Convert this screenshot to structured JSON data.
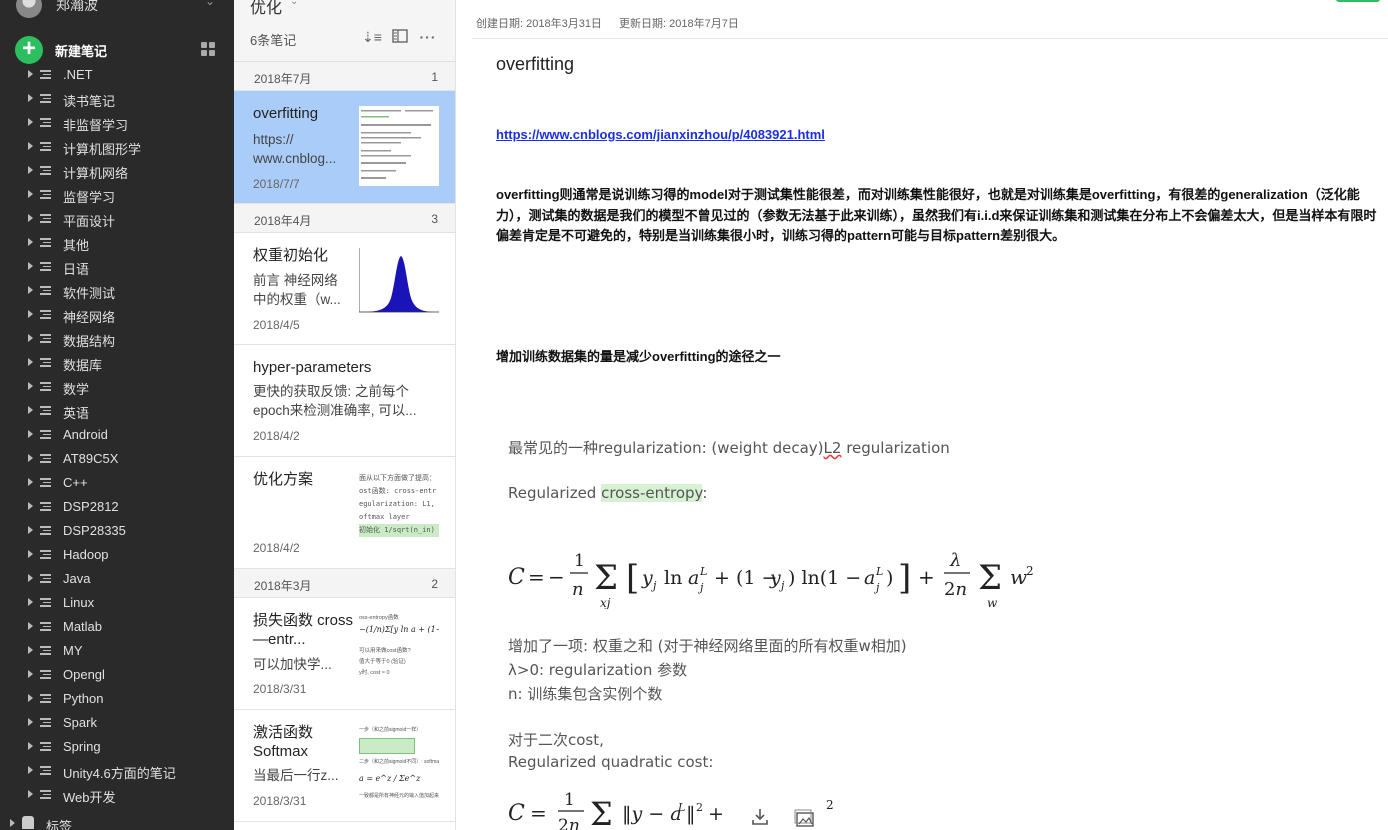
{
  "sidebar": {
    "username": "郑瀚波",
    "new_note_label": "新建笔记",
    "notebooks": [
      ".NET",
      "读书笔记",
      "非监督学习",
      "计算机图形学",
      "计算机网络",
      "监督学习",
      "平面设计",
      "其他",
      "日语",
      "软件测试",
      "神经网络",
      "数据结构",
      "数据库",
      "数学",
      "英语",
      "Android",
      "AT89C5X",
      "C++",
      "DSP2812",
      "DSP28335",
      "Hadoop",
      "Java",
      "Linux",
      "Matlab",
      "MY",
      "Opengl",
      "Python",
      "Spark",
      "Spring",
      "Unity4.6方面的笔记",
      "Web开发"
    ],
    "tags_label": "标签"
  },
  "notelist": {
    "notebook_title": "优化",
    "count_label": "6条笔记",
    "groups": [
      {
        "name": "2018年7月",
        "count": "1"
      },
      {
        "name": "2018年4月",
        "count": "3"
      },
      {
        "name": "2018年3月",
        "count": "2"
      }
    ],
    "notes": [
      {
        "title": "overfitting",
        "snippet": "https:// www.cnblog...",
        "date": "2018/7/7"
      },
      {
        "title": "权重初始化",
        "snippet": "前言 神经网络中的权重（w...",
        "date": "2018/4/5"
      },
      {
        "title": "hyper-parameters",
        "snippet": "更快的获取反馈: 之前每个epoch来检测准确率, 可以...",
        "date": "2018/4/2"
      },
      {
        "title": "优化方案",
        "snippet": "",
        "date": "2018/4/2"
      },
      {
        "title": "损失函数 cross—entr...",
        "snippet": "可以加快学...",
        "date": "2018/3/31"
      },
      {
        "title": "激活函数 Softmax",
        "snippet": "当最后一行z...",
        "date": "2018/3/31"
      }
    ],
    "thumb_text": {
      "opt_lines": [
        "面从以下方面做了提高：",
        "ost函数: cross-entr",
        "egularization: L1,",
        "oftmax layer",
        "初始化 1/sqrt(n_in)"
      ],
      "loss_lines": [
        "oss-entropy函数",
        "可以用来做cost函数?",
        "值大于等于0 (验证)",
        "y时, cost ≈ 0"
      ],
      "act_lines": [
        "一步（和之前sigmoid一样）",
        "二步（和之前sigmoid不同）: softmax函",
        "一致都是所有神经元的输入值加起来"
      ]
    }
  },
  "editor": {
    "created": "创建日期: 2018年3月31日",
    "updated": "更新日期: 2018年7月7日",
    "title": "overfitting",
    "link": "https://www.cnblogs.com/jianxinzhou/p/4083921.html",
    "paragraph": "overfitting则通常是说训练习得的model对于测试集性能很差，而对训练集性能很好，也就是对训练集是overfitting，有很差的generalization（泛化能力），测试集的数据是我们的模型不曾见过的（参数无法基于此来训练），虽然我们有i.i.d来保证训练集和测试集在分布上不会偏差太大，但是当样本有限时偏差肯定是不可避免的，特别是当训练集很小时，训练习得的pattern可能与目标pattern差别很大。",
    "paragraph2": "增加训练数据集的量是减少overfitting的途径之一",
    "embed": {
      "line1_pre": "最常见的一种regularization: (weight decay)",
      "line1_sq": "L2",
      "line1_post": " regularization",
      "line2_pre": "Regularized ",
      "line2_hl": "cross-entropy",
      "line2_post": ":",
      "line3": "增加了一项: 权重之和 (对于神经网络里面的所有权重w相加)",
      "line4": "λ>0: regularization 参数",
      "line5": "n: 训练集包含实例个数",
      "line6": "对于二次cost,",
      "line7": "Regularized quadratic cost:"
    }
  }
}
